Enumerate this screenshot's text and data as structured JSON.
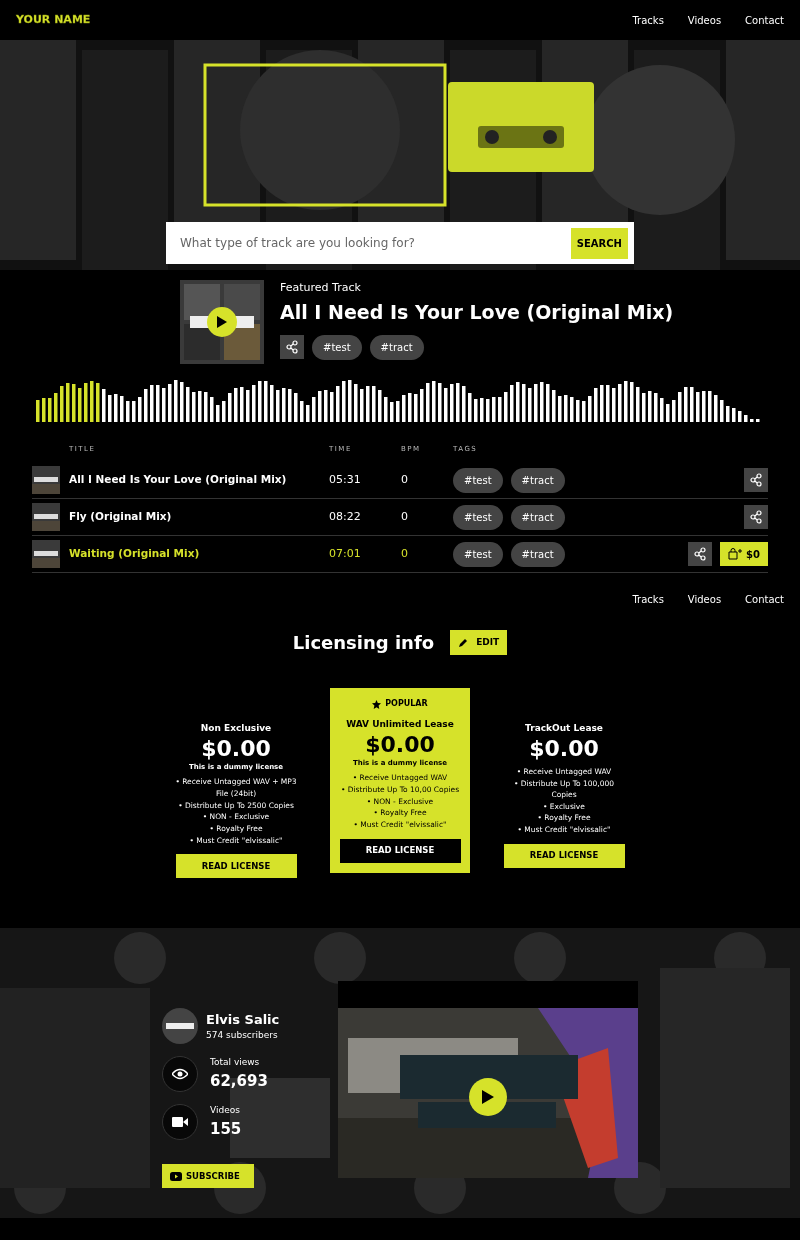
{
  "navbar": {
    "logo": "YOUR NAME",
    "links": [
      {
        "label": "Tracks"
      },
      {
        "label": "Videos"
      },
      {
        "label": "Contact"
      }
    ]
  },
  "search": {
    "placeholder": "What type of track are you looking for?",
    "button": "SEARCH"
  },
  "featured": {
    "label": "Featured Track",
    "title": "All I Need Is Your Love (Original Mix)",
    "tags": [
      "#test",
      "#tract"
    ]
  },
  "waveform": {
    "level": 0.09
  },
  "tracks": {
    "columns": [
      "TITLE",
      "TIME",
      "BPM",
      "TAGS"
    ],
    "rows": [
      {
        "title": "All I Need Is Your Love (Original Mix)",
        "time": "05:31",
        "bpm": "0",
        "tags": [
          "#test",
          "#tract"
        ],
        "selected": false
      },
      {
        "title": "Fly (Original Mix)",
        "time": "08:22",
        "bpm": "0",
        "tags": [
          "#test",
          "#tract"
        ],
        "selected": false
      },
      {
        "title": "Waiting (Original Mix)",
        "time": "07:01",
        "bpm": "0",
        "tags": [
          "#test",
          "#tract"
        ],
        "selected": true,
        "price": "$0"
      }
    ]
  },
  "footer_links": [
    {
      "label": "Tracks"
    },
    {
      "label": "Videos"
    },
    {
      "label": "Contact"
    }
  ],
  "licensing": {
    "title": "Licensing info",
    "edit": "EDIT",
    "plans": [
      {
        "featured": false,
        "name": "Non Exclusive",
        "price": "$0.00",
        "subtitle": "This is a dummy license",
        "features": [
          "• Receive Untagged WAV + MP3 File (24bit)",
          "• Distribute Up To 2500 Copies",
          "• NON - Exclusive",
          "• Royalty Free",
          "• Must Credit \"elvissalic\""
        ],
        "button": "READ LICENSE"
      },
      {
        "featured": true,
        "badge": "POPULAR",
        "name": "WAV Unlimited Lease",
        "price": "$0.00",
        "subtitle": "This is a dummy license",
        "features": [
          "• Receive Untagged WAV",
          "• Distribute Up To 10,00 Copies",
          "• NON - Exclusive",
          "• Royalty Free",
          "• Must Credit \"elvissalic\""
        ],
        "button": "READ LICENSE"
      },
      {
        "featured": false,
        "name": "TrackOut Lease",
        "price": "$0.00",
        "features": [
          "• Receive Untagged WAV",
          "• Distribute Up To 100,000 Copies",
          "• Exclusive",
          "• Royalty Free",
          "• Must Credit \"elvissalic\""
        ],
        "button": "READ LICENSE"
      }
    ]
  },
  "channel": {
    "name": "Elvis Salic",
    "subscribers": "574 subscribers",
    "stats": [
      {
        "kind": "views",
        "label": "Total views",
        "value": "62,693"
      },
      {
        "kind": "videos",
        "label": "Videos",
        "value": "155"
      }
    ],
    "subscribe": "SUBSCRIBE"
  }
}
